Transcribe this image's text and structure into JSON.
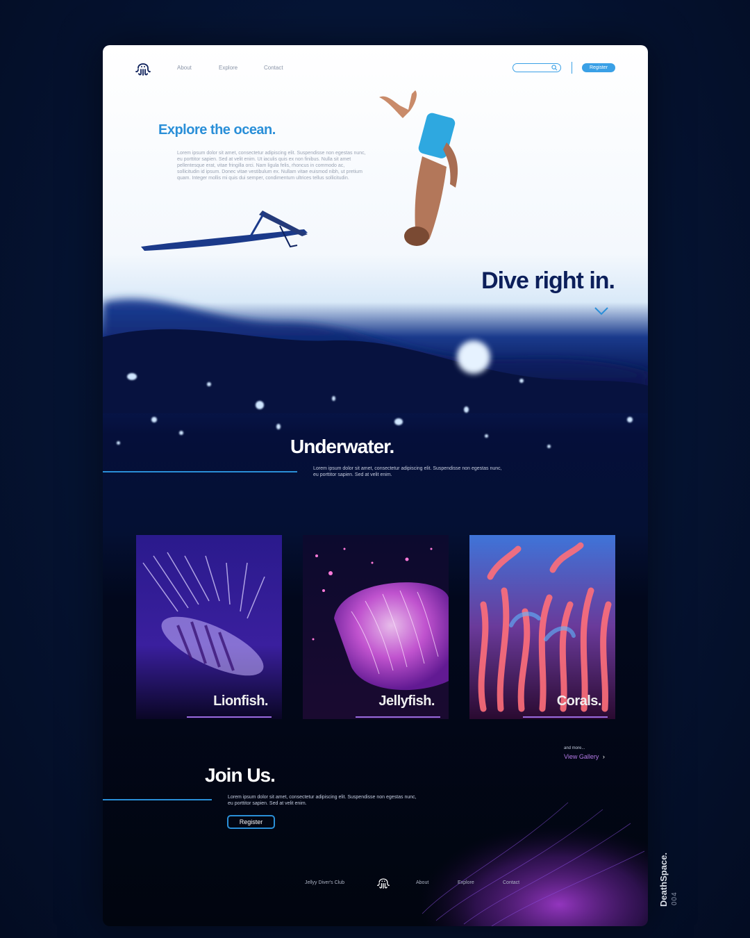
{
  "nav": {
    "links": [
      "About",
      "Explore",
      "Contact"
    ],
    "search_placeholder": "",
    "register_label": "Register"
  },
  "hero": {
    "title": "Explore the ocean.",
    "body": "Lorem ipsum dolor sit amet, consectetur adipiscing elit. Suspendisse non egestas nunc, eu porttitor sapien. Sed at velit enim. Ut iaculis quis ex non finibus. Nulla sit amet pellentesque erat, vitae fringilla orci. Nam ligula felis, rhoncus in commodo ac, sollicitudin id ipsum. Donec vitae vestibulum ex. Nullam vitae euismod nibh, ut pretium quam. Integer mollis mi quis dui semper, condimentum ultrices tellus sollicitudin.",
    "headline": "Dive right in."
  },
  "underwater": {
    "title": "Underwater.",
    "body": "Lorem ipsum dolor sit amet, consectetur adipiscing elit. Suspendisse non egestas nunc, eu porttitor sapien. Sed at velit enim."
  },
  "cards": [
    {
      "label": "Lionfish."
    },
    {
      "label": "Jellyfish."
    },
    {
      "label": "Corals."
    }
  ],
  "gallery": {
    "and_more": "and more...",
    "view_gallery": "View Gallery"
  },
  "join": {
    "title": "Join Us.",
    "body": "Lorem ipsum dolor sit amet, consectetur adipiscing elit. Suspendisse non egestas nunc, eu porttitor sapien. Sed at velit enim.",
    "register_label": "Register"
  },
  "footer": {
    "club_name": "Jellyy Diver's Club",
    "links": [
      "About",
      "Explore",
      "Contact"
    ]
  },
  "signature": {
    "brand": "DeathSpace.",
    "number": "004"
  },
  "colors": {
    "accent": "#2a8fd8",
    "navy": "#0c1f5a",
    "purple": "#9b6be0"
  }
}
